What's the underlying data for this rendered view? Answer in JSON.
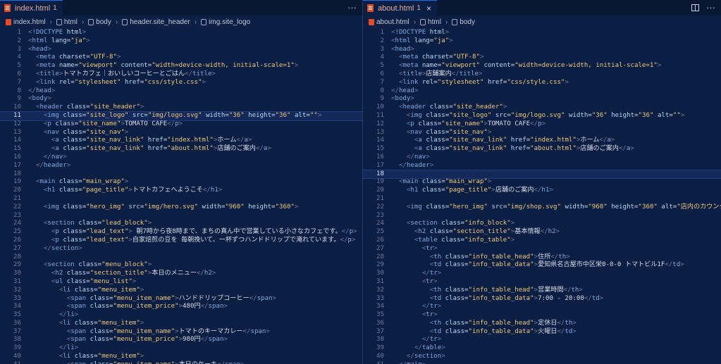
{
  "left": {
    "tab": {
      "label": "index.html",
      "dirty": "1"
    },
    "actions": {
      "more": "···"
    },
    "breadcrumb": [
      "index.html",
      "html",
      "body",
      "header.site_header",
      "img.site_logo"
    ],
    "active_line": 11,
    "lines": [
      [
        "1",
        "<!DOCTYPE html>"
      ],
      [
        "2",
        "<html lang=\"ja\">"
      ],
      [
        "3",
        "<head>"
      ],
      [
        "4",
        "  <meta charset=\"UTF-8\">"
      ],
      [
        "5",
        "  <meta name=\"viewport\" content=\"width=device-width, initial-scale=1\">"
      ],
      [
        "6",
        "  <title>トマトカフェ｜おいしいコーヒーとごはん</title>"
      ],
      [
        "7",
        "  <link rel=\"stylesheet\" href=\"css/style.css\">"
      ],
      [
        "8",
        "</head>"
      ],
      [
        "9",
        "<body>"
      ],
      [
        "10",
        "  <header class=\"site_header\">"
      ],
      [
        "11",
        "    <img class=\"site_logo\" src=\"img/logo.svg\" width=\"36\" height=\"36\" alt=\"\">"
      ],
      [
        "12",
        "    <p class=\"site_name\">TOMATO CAFE</p>"
      ],
      [
        "13",
        "    <nav class=\"site_nav\">"
      ],
      [
        "14",
        "      <a class=\"site_nav_link\" href=\"index.html\">ホーム</a>"
      ],
      [
        "15",
        "      <a class=\"site_nav_link\" href=\"about.html\">店舗のご案内</a>"
      ],
      [
        "16",
        "    </nav>"
      ],
      [
        "17",
        "  </header>"
      ],
      [
        "18",
        ""
      ],
      [
        "19",
        "  <main class=\"main_wrap\">"
      ],
      [
        "20",
        "    <h1 class=\"page_title\">トマトカフェへようこそ</h1>"
      ],
      [
        "21",
        ""
      ],
      [
        "22",
        "    <img class=\"hero_img\" src=\"img/hero.svg\" width=\"960\" height=\"360\">"
      ],
      [
        "23",
        ""
      ],
      [
        "24",
        "    <section class=\"lead_block\">"
      ],
      [
        "25",
        "      <p class=\"lead_text\"> 朝7時から夜8時まで、まちの真ん中で営業している小さなカフェです。</p>"
      ],
      [
        "26",
        "      <p class=\"lead_text\">自家焙煎の豆を 毎朝挽いて、一杯ずつハンドドリップで淹れています。</p>"
      ],
      [
        "27",
        "    </section>"
      ],
      [
        "28",
        ""
      ],
      [
        "29",
        "    <section class=\"menu_block\">"
      ],
      [
        "30",
        "      <h2 class=\"section_title\">本日のメニュー</h2>"
      ],
      [
        "31",
        "      <ul class=\"menu_list\">"
      ],
      [
        "32",
        "        <li class=\"menu_item\">"
      ],
      [
        "33",
        "          <span class=\"menu_item_name\">ハンドドリップコーヒー</span>"
      ],
      [
        "34",
        "          <span class=\"menu_item_price\">480円</span>"
      ],
      [
        "35",
        "        </li>"
      ],
      [
        "36",
        "        <li class=\"menu_item\">"
      ],
      [
        "37",
        "          <span class=\"menu_item_name\">トマトのキーマカレー</span>"
      ],
      [
        "38",
        "          <span class=\"menu_item_price\">980円</span>"
      ],
      [
        "39",
        "        </li>"
      ],
      [
        "40",
        "        <li class=\"menu_item\">"
      ],
      [
        "41",
        "          <span class=\"menu_item_name\">本日のケーキ</span>"
      ]
    ]
  },
  "right": {
    "tab": {
      "label": "about.html",
      "dirty": "1",
      "close": "×"
    },
    "breadcrumb": [
      "about.html",
      "html",
      "body"
    ],
    "active_line": 18,
    "lines": [
      [
        "1",
        "<!DOCTYPE html>"
      ],
      [
        "2",
        "<html lang=\"ja\">"
      ],
      [
        "3",
        "<head>"
      ],
      [
        "4",
        "  <meta charset=\"UTF-8\">"
      ],
      [
        "5",
        "  <meta name=\"viewport\" content=\"width=device-width, initial-scale=1\">"
      ],
      [
        "6",
        "  <title>店舗案内</title>"
      ],
      [
        "7",
        "  <link rel=\"stylesheet\" href=\"css/style.css\">"
      ],
      [
        "8",
        "</head>"
      ],
      [
        "9",
        "<body>"
      ],
      [
        "10",
        "  <header class=\"site_header\">"
      ],
      [
        "11",
        "    <img class=\"site_logo\" src=\"img/logo.svg\" width=\"36\" height=\"36\" alt=\"\">"
      ],
      [
        "12",
        "    <p class=\"site_name\">TOMATO CAFE</p>"
      ],
      [
        "13",
        "    <nav class=\"site_nav\">"
      ],
      [
        "14",
        "      <a class=\"site_nav_link\" href=\"index.html\">ホーム</a>"
      ],
      [
        "15",
        "      <a class=\"site_nav_link\" href=\"about.html\">店舗のご案内</a>"
      ],
      [
        "16",
        "    </nav>"
      ],
      [
        "17",
        "  </header>"
      ],
      [
        "18",
        ""
      ],
      [
        "19",
        "  <main class=\"main_wrap\">"
      ],
      [
        "20",
        "    <h1 class=\"page_title\">店舗のご案内</h1>"
      ],
      [
        "21",
        ""
      ],
      [
        "22",
        "    <img class=\"hero_img\" src=\"img/shop.svg\" width=\"960\" height=\"360\" alt=\"店内のカウンター席\">"
      ],
      [
        "23",
        ""
      ],
      [
        "24",
        "    <section class=\"info_block\">"
      ],
      [
        "25",
        "      <h2 class=\"section_title\">基本情報</h2>"
      ],
      [
        "26",
        "      <table class=\"info_table\">"
      ],
      [
        "27",
        "        <tr>"
      ],
      [
        "28",
        "          <th class=\"info_table_head\">住所</th>"
      ],
      [
        "29",
        "          <td class=\"info_table_data\">愛知県名古屋市中区栄0-0-0 トマトビル1F</td>"
      ],
      [
        "30",
        "        </tr>"
      ],
      [
        "31",
        "        <tr>"
      ],
      [
        "32",
        "          <th class=\"info_table_head\">営業時間</th>"
      ],
      [
        "33",
        "          <td class=\"info_table_data\">7:00 - 20:00</td>"
      ],
      [
        "34",
        "        </tr>"
      ],
      [
        "35",
        "        <tr>"
      ],
      [
        "36",
        "          <th class=\"info_table_head\">定休日</th>"
      ],
      [
        "37",
        "          <td class=\"info_table_data\">火曜日</td>"
      ],
      [
        "38",
        "        </tr>"
      ],
      [
        "39",
        "      </table>"
      ],
      [
        "40",
        "    </section>"
      ],
      [
        "41",
        "  </main>"
      ]
    ]
  },
  "colors": {
    "editor_bg": "#0b1f44",
    "tab_bg": "#081733",
    "active_tab_border": "#1f6feb",
    "tag": "#7fa8e0",
    "attr": "#b7dcf5",
    "string": "#f0c87a",
    "line_number": "#6c7a99"
  }
}
